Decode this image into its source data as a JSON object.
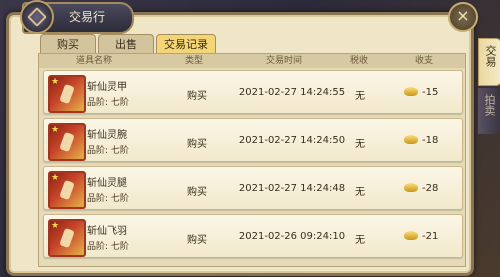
{
  "window": {
    "title": "交易行",
    "close": "×"
  },
  "side_tabs": [
    {
      "label": "交易"
    },
    {
      "label": "拍卖"
    }
  ],
  "tabs": [
    {
      "label": "购买"
    },
    {
      "label": "出售"
    },
    {
      "label": "交易记录"
    }
  ],
  "table": {
    "headers": [
      "道具名称",
      "类型",
      "交易时间",
      "税收",
      "收支"
    ],
    "rows": [
      {
        "name": "斩仙灵甲",
        "grade": "品阶: 七阶",
        "type": "购买",
        "time": "2021-02-27  14:24:55",
        "tax": "无",
        "amount": "-15",
        "icon": "armor-icon"
      },
      {
        "name": "斩仙灵腕",
        "grade": "品阶: 七阶",
        "type": "购买",
        "time": "2021-02-27  14:24:50",
        "tax": "无",
        "amount": "-18",
        "icon": "bracer-icon"
      },
      {
        "name": "斩仙灵腿",
        "grade": "品阶: 七阶",
        "type": "购买",
        "time": "2021-02-27  14:24:48",
        "tax": "无",
        "amount": "-28",
        "icon": "leggings-icon"
      },
      {
        "name": "斩仙飞羽",
        "grade": "品阶: 七阶",
        "type": "购买",
        "time": "2021-02-26  09:24:10",
        "tax": "无",
        "amount": "-21",
        "icon": "feather-icon"
      }
    ]
  },
  "colors": {
    "active_tab": "#f3d476",
    "panel": "#efe6c8",
    "item_border": "#a0361f"
  }
}
